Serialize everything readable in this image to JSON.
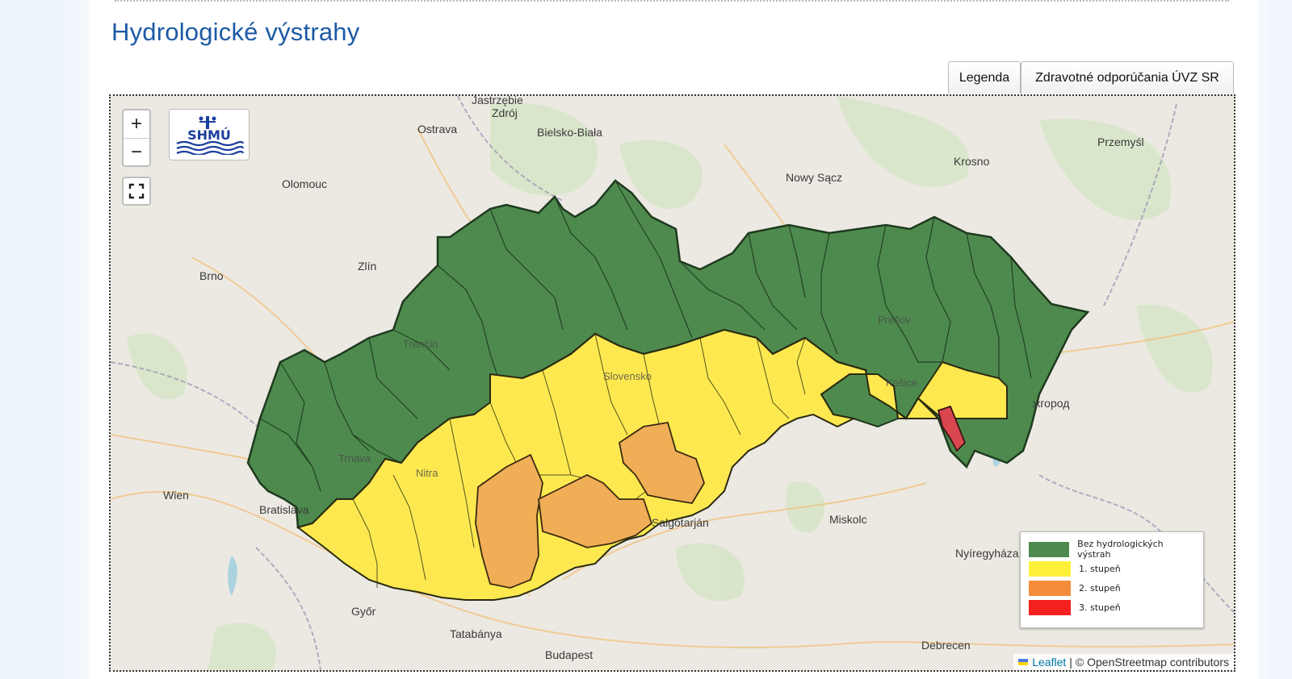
{
  "page": {
    "title": "Hydrologické výstrahy"
  },
  "tabs": {
    "legend_label": "Legenda",
    "health_label": "Zdravotné odporúčania ÚVZ SR"
  },
  "map": {
    "zoom_in": "+",
    "zoom_out": "−",
    "fullscreen_icon": "fullscreen-icon",
    "logo_text": "SHMÚ",
    "cities": {
      "ostrava": "Ostrava",
      "zdroj": "Zdrój",
      "bielsko": "Bielsko-Biała",
      "olomouc": "Olomouc",
      "nowy_sacz": "Nowy Sącz",
      "krosno": "Krosno",
      "przemysl": "Przemyśl",
      "brno": "Brno",
      "zlin": "Zlín",
      "trencin": "Trenčín",
      "presov": "Prešov",
      "slovensko": "Slovensko",
      "kosice": "Košice",
      "uzhhorod": "жгород",
      "trnava": "Trnava",
      "nitra": "Nitra",
      "wien": "Wien",
      "bratislava": "Bratislava",
      "salgotarjan": "Salgótarján",
      "miskolc": "Miskolc",
      "nyiregyhaza": "Nyíregyháza",
      "gyor": "Győr",
      "tatabanya": "Tatabánya",
      "budapest": "Budapest",
      "debrecen": "Debrecen",
      "justrzebie": "Jastrzębie"
    },
    "legend": [
      {
        "label": "Bez hydrologických výstrah",
        "color": "#4e8a4e"
      },
      {
        "label": "1. stupeň",
        "color": "#fff03a"
      },
      {
        "label": "2. stupeň",
        "color": "#f28c3a"
      },
      {
        "label": "3. stupeň",
        "color": "#f52020"
      }
    ],
    "attribution": {
      "leaflet": "Leaflet",
      "separator": "|",
      "copyright": "© OpenStreetmap contributors"
    }
  },
  "colors": {
    "title": "#1d5aa6",
    "green_region": "#4e8a4e",
    "yellow_region": "#fde94f",
    "orange_region": "#f0ae56",
    "red_region": "#d9474f"
  }
}
